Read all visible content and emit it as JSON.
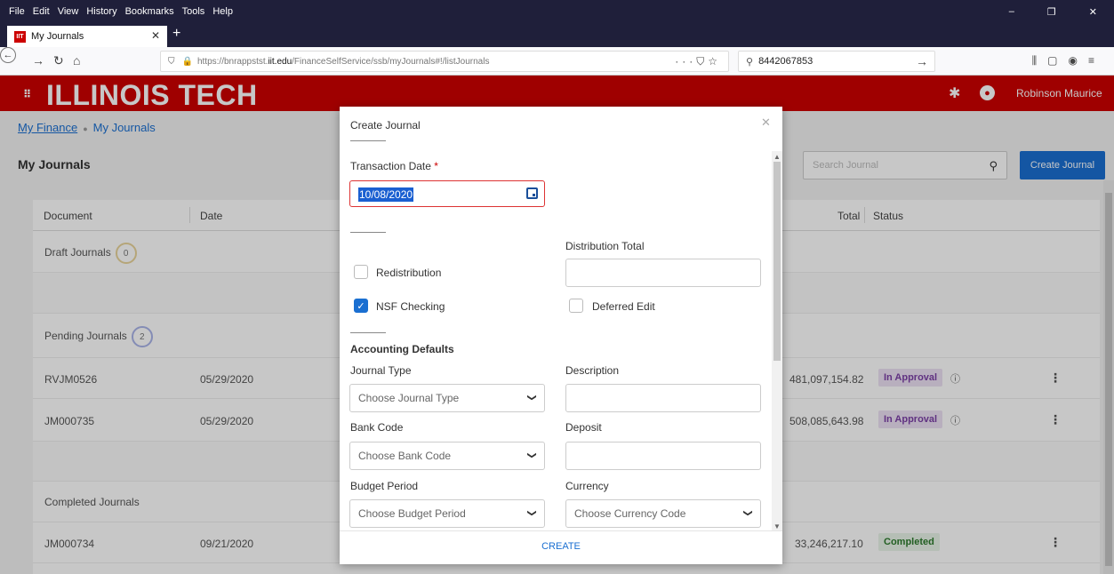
{
  "browser": {
    "menu": [
      "File",
      "Edit",
      "View",
      "History",
      "Bookmarks",
      "Tools",
      "Help"
    ],
    "tab_title": "My Journals",
    "url_prefix": "https://bnrappstst.",
    "url_domain": "iit.edu",
    "url_path": "/FinanceSelfService/ssb/myJournals#!/listJournals",
    "search_value": "8442067853"
  },
  "header": {
    "logo": "ILLINOIS TECH",
    "user_name": "Robinson Maurice"
  },
  "breadcrumb": {
    "item1": "My Finance",
    "item2": "My Journals"
  },
  "page": {
    "title": "My Journals",
    "search_placeholder": "Search Journal",
    "create_button": "Create Journal"
  },
  "table": {
    "headers": {
      "document": "Document",
      "date": "Date",
      "total": "Total",
      "status": "Status"
    },
    "sections": {
      "draft": {
        "label": "Draft Journals",
        "count": "0"
      },
      "pending": {
        "label": "Pending Journals",
        "count": "2"
      },
      "completed": {
        "label": "Completed Journals"
      }
    },
    "rows": [
      {
        "document": "RVJM0526",
        "date": "05/29/2020",
        "total": "481,097,154.82",
        "status": "In Approval"
      },
      {
        "document": "JM000735",
        "date": "05/29/2020",
        "total": "508,085,643.98",
        "status": "In Approval"
      },
      {
        "document": "JM000734",
        "date": "09/21/2020",
        "total": "33,246,217.10",
        "status": "Completed"
      }
    ]
  },
  "modal": {
    "title": "Create Journal",
    "transaction_date_label": "Transaction Date",
    "required_mark": "*",
    "transaction_date_value": "10/08/2020",
    "distribution_total_label": "Distribution Total",
    "redistribution_label": "Redistribution",
    "nsf_checking_label": "NSF Checking",
    "deferred_edit_label": "Deferred Edit",
    "accounting_defaults_label": "Accounting Defaults",
    "journal_type_label": "Journal Type",
    "journal_type_placeholder": "Choose Journal Type",
    "description_label": "Description",
    "bank_code_label": "Bank Code",
    "bank_code_placeholder": "Choose Bank Code",
    "deposit_label": "Deposit",
    "budget_period_label": "Budget Period",
    "budget_period_placeholder": "Choose Budget Period",
    "currency_label": "Currency",
    "currency_placeholder": "Choose Currency Code",
    "create_button": "CREATE"
  }
}
